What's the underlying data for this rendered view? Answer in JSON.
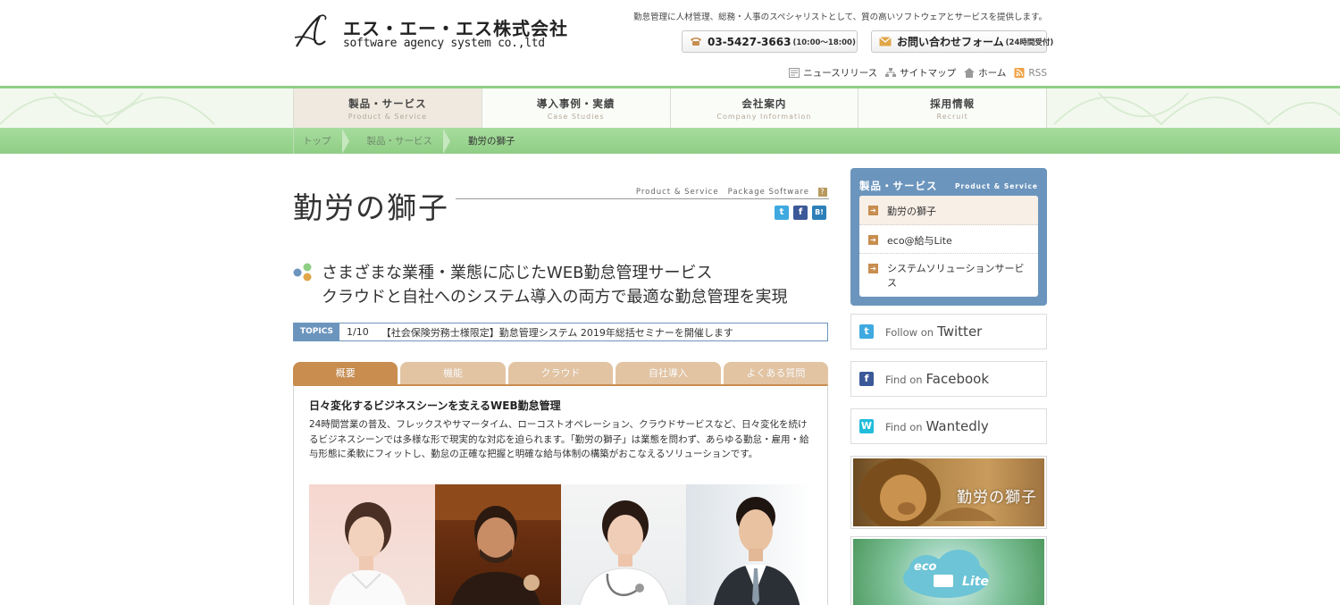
{
  "header": {
    "logo_jp": "エス・エー・エス株式会社",
    "logo_en": "software agency system co.,ltd",
    "tagline": "勤怠管理に人材管理、総務・人事のスペシャリストとして、質の高いソフトウェアとサービスを提供します。",
    "phone": "03-5427-3663",
    "phone_hours": "(10:00～18:00)",
    "contact_label": "お問い合わせフォーム",
    "contact_note": "(24時間受付)",
    "util_links": [
      "ニュースリリース",
      "サイトマップ",
      "ホーム",
      "RSS"
    ]
  },
  "nav": [
    {
      "jp": "製品・サービス",
      "en": "Product & Service"
    },
    {
      "jp": "導入事例・実績",
      "en": "Case Studies"
    },
    {
      "jp": "会社案内",
      "en": "Company Information"
    },
    {
      "jp": "採用情報",
      "en": "Recruit"
    }
  ],
  "breadcrumb": [
    "トップ",
    "製品・サービス",
    "勤労の獅子"
  ],
  "page": {
    "title": "勤労の獅子",
    "cat1": "Product & Service",
    "cat2": "Package Software",
    "help": "?",
    "lead1": "さまざまな業種・業態に応じたWEB勤怠管理サービス",
    "lead2": "クラウドと自社へのシステム導入の両方で最適な勤怠管理を実現"
  },
  "topics": {
    "tag": "TOPICS",
    "date": "1/10",
    "text": "【社会保険労務士様限定】勤怠管理システム 2019年総括セミナーを開催します"
  },
  "tabs": [
    "概要",
    "機能",
    "クラウド",
    "自社導入",
    "よくある質問"
  ],
  "section": {
    "heading": "日々変化するビジネスシーンを支えるWEB勤怠管理",
    "body": "24時間営業の普及、フレックスやサマータイム、ローコストオペレーション、クラウドサービスなど、日々変化を続けるビジネスシーンでは多様な形で現実的な対応を迫られます。「勤労の獅子」は業態を問わず、あらゆる勤怠・雇用・給与形態に柔軟にフィットし、勤怠の正確な把握と明確な給与体制の構築がおこなえるソリューションです。"
  },
  "sidebar": {
    "heading": "製品・サービス",
    "heading_en": "Product & Service",
    "items": [
      "勤労の獅子",
      "eco@給与Lite",
      "システムソリューションサービス"
    ],
    "twitter": {
      "pre": "Follow on",
      "name": "Twitter"
    },
    "facebook": {
      "pre": "Find on",
      "name": "Facebook"
    },
    "wantedly": {
      "pre": "Find on",
      "name": "Wantedly"
    },
    "banner1": "勤労の獅子",
    "banner2_a": "eco",
    "banner2_b": "Lite"
  },
  "colors": {
    "nav_green": "#8fcf85",
    "side_blue": "#6c95bd",
    "tab_active": "#c88d4f",
    "tab_inactive": "#e2c4a3"
  }
}
